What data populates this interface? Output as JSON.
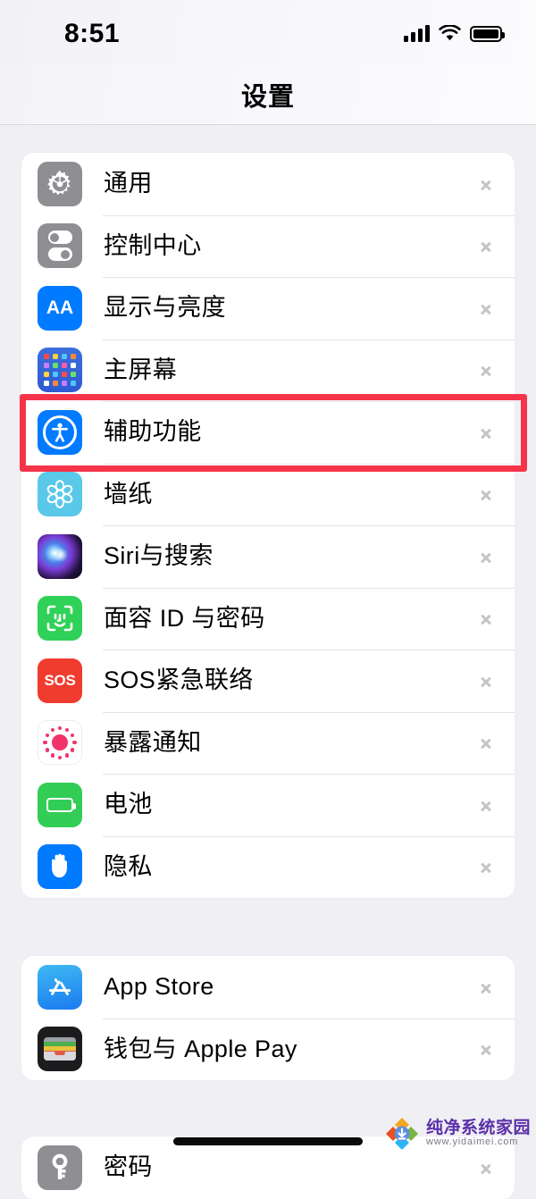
{
  "status_bar": {
    "time": "8:51",
    "signal_icon": "cellular-signal-icon",
    "wifi_icon": "wifi-icon",
    "battery_icon": "battery-icon"
  },
  "header": {
    "title": "设置"
  },
  "colors": {
    "page_background": "#EFEFF4",
    "card_background": "#FFFFFF",
    "separator": "#E3E3E6",
    "chevron": "#C4C4C8",
    "highlight_border": "#F5344A",
    "accent_blue": "#007AFF",
    "gray_icon": "#8E8E93",
    "green_icon": "#32CD55",
    "red_icon": "#F03C2E"
  },
  "highlight": {
    "target_row": "辅助功能",
    "border_color": "#F5344A"
  },
  "groups": [
    {
      "name": "system-group",
      "rows": [
        {
          "label": "通用",
          "icon": "gear-icon",
          "chevron": "chevron-right-icon"
        },
        {
          "label": "控制中心",
          "icon": "control-center-icon",
          "chevron": "chevron-right-icon"
        },
        {
          "label": "显示与亮度",
          "icon": "display-brightness-icon",
          "chevron": "chevron-right-icon"
        },
        {
          "label": "主屏幕",
          "icon": "home-screen-icon",
          "chevron": "chevron-right-icon"
        },
        {
          "label": "辅助功能",
          "icon": "accessibility-icon",
          "chevron": "chevron-right-icon"
        },
        {
          "label": "墙纸",
          "icon": "wallpaper-icon",
          "chevron": "chevron-right-icon"
        },
        {
          "label": "Siri与搜索",
          "icon": "siri-icon",
          "chevron": "chevron-right-icon"
        },
        {
          "label": "面容 ID 与密码",
          "icon": "face-id-icon",
          "chevron": "chevron-right-icon"
        },
        {
          "label": "SOS紧急联络",
          "icon": "sos-icon",
          "chevron": "chevron-right-icon"
        },
        {
          "label": "暴露通知",
          "icon": "exposure-notification-icon",
          "chevron": "chevron-right-icon"
        },
        {
          "label": "电池",
          "icon": "battery-settings-icon",
          "chevron": "chevron-right-icon"
        },
        {
          "label": "隐私",
          "icon": "privacy-hand-icon",
          "chevron": "chevron-right-icon"
        }
      ]
    },
    {
      "name": "store-group",
      "rows": [
        {
          "label": "App Store",
          "icon": "app-store-icon",
          "chevron": "chevron-right-icon"
        },
        {
          "label": "钱包与 Apple Pay",
          "icon": "wallet-icon",
          "chevron": "chevron-right-icon"
        }
      ]
    },
    {
      "name": "accounts-group",
      "rows": [
        {
          "label": "密码",
          "icon": "passwords-key-icon",
          "chevron": "chevron-right-icon"
        }
      ]
    }
  ],
  "home_indicator": {
    "name": "home-indicator"
  },
  "watermark": {
    "title": "纯净系统家园",
    "url": "www.yidaimei.com"
  }
}
